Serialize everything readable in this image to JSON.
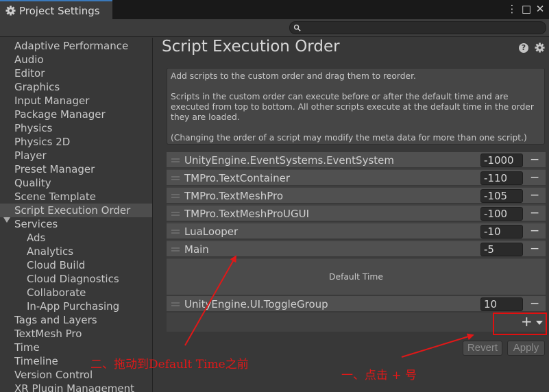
{
  "window": {
    "title": "Project Settings",
    "controls": [
      "⋮",
      "□",
      "✕"
    ]
  },
  "search": {
    "value": "",
    "placeholder": ""
  },
  "sidebar": {
    "items": [
      {
        "label": "Adaptive Performance"
      },
      {
        "label": "Audio"
      },
      {
        "label": "Editor"
      },
      {
        "label": "Graphics"
      },
      {
        "label": "Input Manager"
      },
      {
        "label": "Package Manager"
      },
      {
        "label": "Physics"
      },
      {
        "label": "Physics 2D"
      },
      {
        "label": "Player"
      },
      {
        "label": "Preset Manager"
      },
      {
        "label": "Quality"
      },
      {
        "label": "Scene Template"
      },
      {
        "label": "Script Execution Order",
        "selected": true
      },
      {
        "label": "Services",
        "expanded": true
      },
      {
        "label": "Ads",
        "child": true
      },
      {
        "label": "Analytics",
        "child": true
      },
      {
        "label": "Cloud Build",
        "child": true
      },
      {
        "label": "Cloud Diagnostics",
        "child": true
      },
      {
        "label": "Collaborate",
        "child": true
      },
      {
        "label": "In-App Purchasing",
        "child": true
      },
      {
        "label": "Tags and Layers"
      },
      {
        "label": "TextMesh Pro"
      },
      {
        "label": "Time"
      },
      {
        "label": "Timeline"
      },
      {
        "label": "Version Control"
      },
      {
        "label": "XR Plugin Management"
      }
    ]
  },
  "main": {
    "title": "Script Execution Order",
    "help_icon": "help-icon",
    "settings_icon": "gear-icon",
    "info": {
      "line1": "Add scripts to the custom order and drag them to reorder.",
      "line2": "Scripts in the custom order can execute before or after the default time and are\nexecuted from top to bottom. All other scripts execute at the default time in the order\nthey are loaded.",
      "line3": "(Changing the order of a script may modify the meta data for more than one script.)"
    },
    "scripts_before": [
      {
        "name": "UnityEngine.EventSystems.EventSystem",
        "order": "-1000"
      },
      {
        "name": "TMPro.TextContainer",
        "order": "-110"
      },
      {
        "name": "TMPro.TextMeshPro",
        "order": "-105"
      },
      {
        "name": "TMPro.TextMeshProUGUI",
        "order": "-100"
      },
      {
        "name": "LuaLooper",
        "order": "-10"
      },
      {
        "name": "Main",
        "order": "-5"
      }
    ],
    "default_time_label": "Default Time",
    "scripts_after": [
      {
        "name": "UnityEngine.UI.ToggleGroup",
        "order": "10"
      }
    ],
    "remove_label": "−",
    "add_label": "+",
    "revert_label": "Revert",
    "apply_label": "Apply"
  },
  "annotations": {
    "drag_note": "二、拖动到Default Time之前",
    "click_note": "一、点击 + 号",
    "color": "#e01818"
  }
}
